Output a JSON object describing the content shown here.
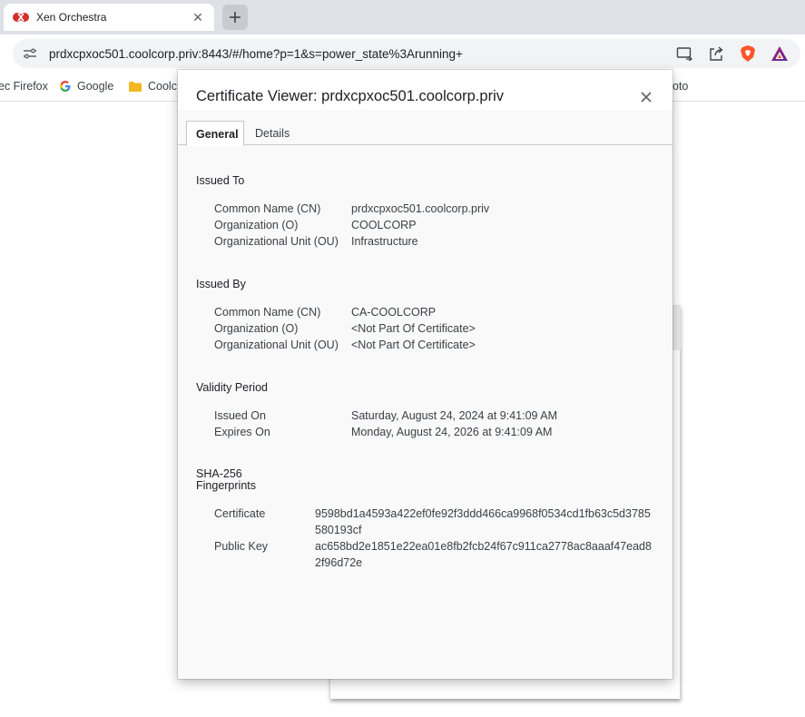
{
  "browser": {
    "tab_title": "Xen Orchestra",
    "url": "prdxcpxoc501.coolcorp.priv:8443/#/home?p=1&s=power_state%3Arunning+",
    "bookmarks": [
      {
        "label": "ec Firefox",
        "icon": "firefox-icon"
      },
      {
        "label": "Google",
        "icon": "google-icon"
      },
      {
        "label": "Coolc",
        "icon": "folder-icon"
      },
      {
        "label": "oto",
        "icon": "none"
      }
    ],
    "brand_color": "#fb542b",
    "favicon_color": "#d32f2f"
  },
  "dialog": {
    "title": "Certificate Viewer: prdxcpxoc501.coolcorp.priv",
    "tabs": [
      {
        "label": "General",
        "active": true
      },
      {
        "label": "Details",
        "active": false
      }
    ],
    "issued_to": {
      "title": "Issued To",
      "rows": [
        {
          "label": "Common Name (CN)",
          "value": "prdxcpxoc501.coolcorp.priv"
        },
        {
          "label": "Organization (O)",
          "value": "COOLCORP"
        },
        {
          "label": "Organizational Unit (OU)",
          "value": "Infrastructure"
        }
      ]
    },
    "issued_by": {
      "title": "Issued By",
      "rows": [
        {
          "label": "Common Name (CN)",
          "value": "CA-COOLCORP"
        },
        {
          "label": "Organization (O)",
          "value": "<Not Part Of Certificate>"
        },
        {
          "label": "Organizational Unit (OU)",
          "value": "<Not Part Of Certificate>"
        }
      ]
    },
    "validity": {
      "title": "Validity Period",
      "rows": [
        {
          "label": "Issued On",
          "value": "Saturday, August 24, 2024 at 9:41:09 AM"
        },
        {
          "label": "Expires On",
          "value": "Monday, August 24, 2026 at 9:41:09 AM"
        }
      ]
    },
    "fingerprints": {
      "title_line1": "SHA-256",
      "title_line2": "Fingerprints",
      "rows": [
        {
          "label": "Certificate",
          "value": "9598bd1a4593a422ef0fe92f3ddd466ca9968f0534cd1fb63c5d3785580193cf"
        },
        {
          "label": "Public Key",
          "value": "ac658bd2e1851e22ea01e8fb2fcb24f67c911ca2778ac8aaaf47ead82f96d72e"
        }
      ]
    }
  }
}
